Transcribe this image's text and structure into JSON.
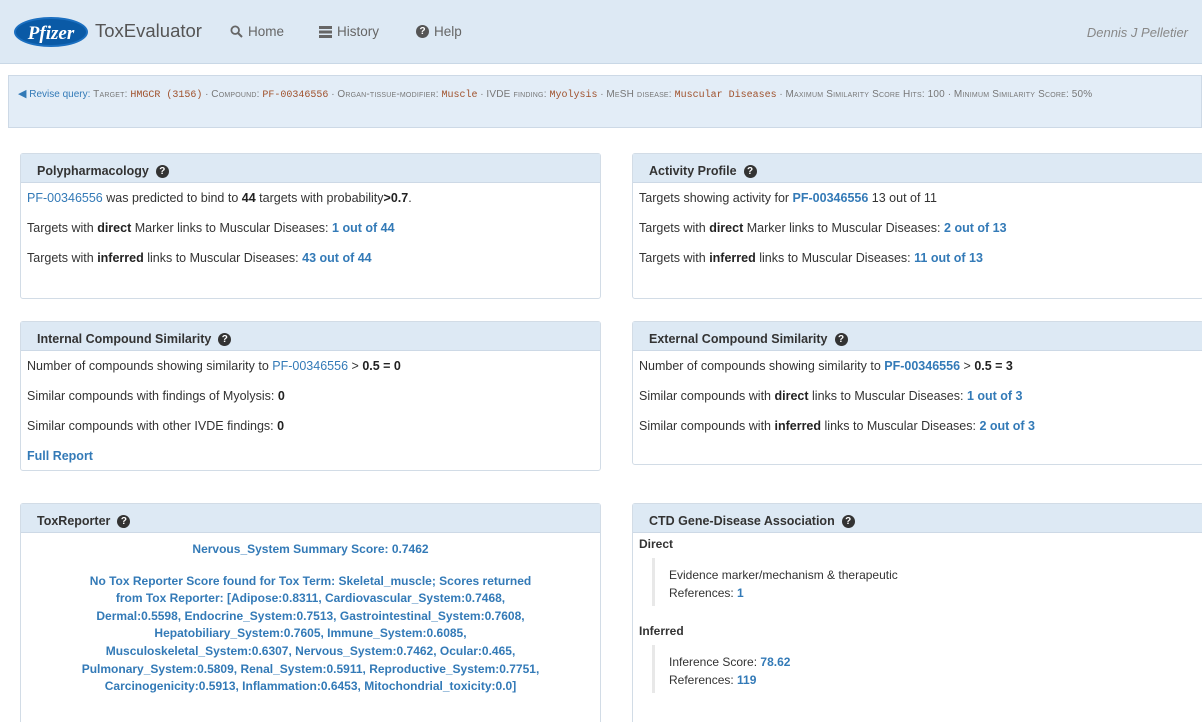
{
  "nav": {
    "logo": "Pfizer",
    "app_name": "ToxEvaluator",
    "home": "Home",
    "history": "History",
    "help": "Help",
    "user": "Dennis J Pelletier"
  },
  "query": {
    "revise": "Revise query:",
    "target_label": "Target:",
    "target_value": "HMGCR (3156)",
    "compound_label": "Compound:",
    "compound_value": "PF-00346556",
    "organ_label": "Organ-tissue-modifier:",
    "organ_value": "Muscle",
    "ivde_label": "IVDE finding:",
    "ivde_value": "Myolysis",
    "mesh_label": "MeSH disease:",
    "mesh_value": "Muscular Diseases",
    "max_label": "Maximum Similarity Score Hits:",
    "max_value": "100",
    "min_label": "Minimum Similarity Score:",
    "min_value": "50%",
    "sep": "·"
  },
  "poly": {
    "title": "Polypharmacology",
    "compound": "PF-00346556",
    "line1_mid": "was predicted to bind to",
    "count": "44",
    "line1_end": "targets with probability",
    "prob": ">0.7",
    "dot": ".",
    "targets_with": "Targets with",
    "direct": "direct",
    "line2_rest": "Marker links to Muscular Diseases:",
    "line2_link": "1 out of 44",
    "inferred": "inferred",
    "line3_rest": "links to Muscular Diseases:",
    "line3_link": "43 out of 44"
  },
  "activity": {
    "title": "Activity Profile",
    "line1_pre": "Targets showing activity for",
    "compound": "PF-00346556",
    "line1_end": "13 out of 11",
    "targets_with": "Targets with",
    "direct": "direct",
    "line2_rest": "Marker links to Muscular Diseases:",
    "line2_link": "2 out of 13",
    "inferred": "inferred",
    "line3_rest": "links to Muscular Diseases:",
    "line3_link": "11 out of 13"
  },
  "internal": {
    "title": "Internal Compound Similarity",
    "line1_pre": "Number of compounds showing similarity to",
    "compound": "PF-00346556",
    "gt": ">",
    "line1_val": "0.5 = 0",
    "line2": "Similar compounds with findings of Myolysis:",
    "line2_val": "0",
    "line3": "Similar compounds with other IVDE findings:",
    "line3_val": "0",
    "full_report": "Full Report"
  },
  "external": {
    "title": "External Compound Similarity",
    "line1_pre": "Number of compounds showing similarity to",
    "compound": "PF-00346556",
    "gt": ">",
    "line1_val": "0.5 = 3",
    "sim_with": "Similar compounds with",
    "direct": "direct",
    "inferred": "inferred",
    "links_rest": "links to Muscular Diseases:",
    "line2_link": "1 out of 3",
    "line3_link": "2 out of 3"
  },
  "toxreporter": {
    "title": "ToxReporter",
    "summary": "Nervous_System Summary Score: 0.7462",
    "lines": [
      "No Tox Reporter Score found for Tox Term: Skeletal_muscle; Scores returned",
      "from Tox Reporter: [Adipose:0.8311, Cardiovascular_System:0.7468,",
      "Dermal:0.5598, Endocrine_System:0.7513, Gastrointestinal_System:0.7608,",
      "Hepatobiliary_System:0.7605, Immune_System:0.6085,",
      "Musculoskeletal_System:0.6307, Nervous_System:0.7462, Ocular:0.465,",
      "Pulmonary_System:0.5809, Renal_System:0.5911, Reproductive_System:0.7751,",
      "Carcinogenicity:0.5913, Inflammation:0.6453, Mitochondrial_toxicity:0.0]"
    ]
  },
  "ctd": {
    "title": "CTD Gene-Disease Association",
    "direct_label": "Direct",
    "direct_evidence": "Evidence marker/mechanism & therapeutic",
    "references_label": "References:",
    "direct_refs": "1",
    "inferred_label": "Inferred",
    "inference_label": "Inference Score:",
    "inference_score": "78.62",
    "inferred_refs": "119"
  }
}
